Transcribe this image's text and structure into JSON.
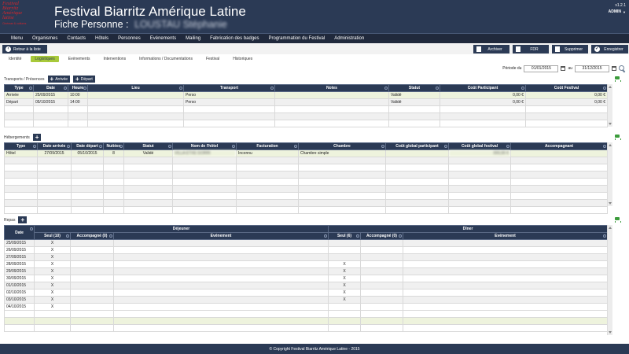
{
  "header": {
    "logo_line1": "Festival",
    "logo_line2": "Biarritz",
    "logo_line3": "Amérique",
    "logo_line4": "latine",
    "logo_tag": "Cinémas & cultures",
    "title": "Festival Biarritz Amérique Latine",
    "subtitle_prefix": "Fiche Personne :",
    "person_name": "LOUSTAU Stéphanie",
    "version": "v1.2.1",
    "user": "ADMIN"
  },
  "nav": [
    "Menu",
    "Organismes",
    "Contacts",
    "Hôtels",
    "Personnes",
    "Evénements",
    "Mailing",
    "Fabrication des badges",
    "Programmation du Festival",
    "Administration"
  ],
  "actions": {
    "back": "Retour à la liste",
    "archive": "Archiver",
    "fdr": "FDR",
    "delete": "Supprimer",
    "save": "Enregistrer"
  },
  "tabs": [
    "Identité",
    "Logistiques",
    "Evénements",
    "Interventions",
    "Informations / Documentations",
    "Festival",
    "Historiques"
  ],
  "active_tab": "Logistiques",
  "period": {
    "label": "Période du",
    "from": "01/01/2015",
    "to_label": "au",
    "to": "31/12/2015"
  },
  "transports": {
    "title": "Transports / Présences",
    "add_arrival": "Arrivée",
    "add_departure": "Départ",
    "columns": [
      "Type",
      "Date",
      "Heure",
      "Lieu",
      "Transport",
      "Notes",
      "Statut",
      "Coût Participant",
      "Coût Festival"
    ],
    "rows": [
      [
        "Arrivée",
        "25/09/2015",
        "10:00",
        "",
        "Perso",
        "",
        "Validé",
        "0,00 €",
        "0,00 €"
      ],
      [
        "Départ",
        "05/10/2015",
        "14:00",
        "",
        "Perso",
        "",
        "Validé",
        "0,00 €",
        "0,00 €"
      ]
    ]
  },
  "hebergements": {
    "title": "Hébergements",
    "columns": [
      "Type",
      "Date arrivée",
      "Date départ",
      "Nuitées",
      "Statut",
      "Nom de l'hôtel",
      "Facturation",
      "Chambre",
      "Coût global participant",
      "Coût global festival",
      "Accompagnant"
    ],
    "rows": [
      [
        "Hôtel",
        "27/09/2015",
        "05/10/2015",
        "8",
        "Validé",
        "VILLA ETXE GORRI",
        "Inconnu",
        "Chambre simple",
        "",
        "000,00 €",
        ""
      ]
    ]
  },
  "repas": {
    "title": "Repas",
    "group_dejeuner": "Déjeuner",
    "group_diner": "Dîner",
    "col_date": "Date",
    "dej_cols": [
      "Seul (10)",
      "Accompagné (0)",
      "Evénement"
    ],
    "din_cols": [
      "Seul (6)",
      "Accompagné (0)",
      "Evénement"
    ],
    "rows": [
      [
        "25/09/2015",
        "X",
        "",
        "",
        "",
        "",
        ""
      ],
      [
        "26/09/2015",
        "X",
        "",
        "",
        "",
        "",
        ""
      ],
      [
        "27/09/2015",
        "X",
        "",
        "",
        "",
        "",
        ""
      ],
      [
        "28/09/2015",
        "X",
        "",
        "",
        "X",
        "",
        ""
      ],
      [
        "29/09/2015",
        "X",
        "",
        "",
        "X",
        "",
        ""
      ],
      [
        "30/09/2015",
        "X",
        "",
        "",
        "X",
        "",
        ""
      ],
      [
        "01/10/2015",
        "X",
        "",
        "",
        "X",
        "",
        ""
      ],
      [
        "02/10/2015",
        "X",
        "",
        "",
        "X",
        "",
        ""
      ],
      [
        "03/10/2015",
        "X",
        "",
        "",
        "X",
        "",
        ""
      ],
      [
        "04/10/2015",
        "X",
        "",
        "",
        "",
        "",
        ""
      ]
    ]
  },
  "footer": "© Copyright Festival Biarritz Amérique Latine - 2015",
  "colors": {
    "primary": "#2b3a55",
    "accent": "#a8c93a",
    "logo_red": "#d8262c",
    "cart_green": "#3c9c3c"
  }
}
